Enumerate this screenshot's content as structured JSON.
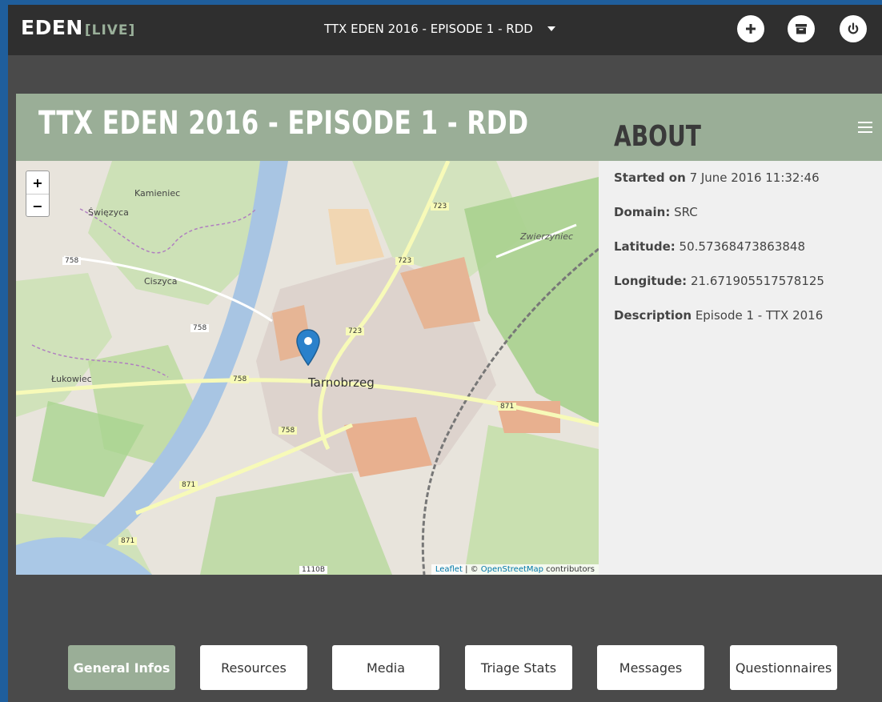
{
  "app": {
    "brand": "EDEN",
    "brand_suffix": "[LIVE]",
    "event_selector": "TTX EDEN 2016 - EPISODE 1 - RDD",
    "icons": [
      "plus-icon",
      "archive-icon",
      "power-icon"
    ]
  },
  "card": {
    "title": "TTX EDEN 2016 - EPISODE 1 - RDD"
  },
  "map": {
    "zoom_in": "+",
    "zoom_out": "−",
    "place_labels": [
      {
        "name": "Kamieniec"
      },
      {
        "name": "Święzyca"
      },
      {
        "name": "Ciszyca"
      },
      {
        "name": "Łukowiec"
      },
      {
        "name": "Tarnobrzeg"
      },
      {
        "name": "Zwierzyniec"
      }
    ],
    "road_labels": [
      "723",
      "723",
      "723",
      "758",
      "758",
      "758",
      "758",
      "871",
      "871",
      "871",
      "1110B"
    ],
    "attribution_leaflet": "Leaflet",
    "attribution_sep": " | © ",
    "attribution_osm": "OpenStreetMap",
    "attribution_tail": " contributors"
  },
  "about": {
    "heading": "ABOUT",
    "started_label": "Started on",
    "started_value": "7 June 2016 11:32:46",
    "domain_label": "Domain:",
    "domain_value": "SRC",
    "latitude_label": "Latitude:",
    "latitude_value": "50.57368473863848",
    "longitude_label": "Longitude:",
    "longitude_value": "21.671905517578125",
    "description_label": "Description",
    "description_value": "Episode 1 - TTX 2016"
  },
  "tabs": [
    {
      "label": "General Infos",
      "active": true
    },
    {
      "label": "Resources",
      "active": false
    },
    {
      "label": "Media",
      "active": false
    },
    {
      "label": "Triage Stats",
      "active": false
    },
    {
      "label": "Messages",
      "active": false
    },
    {
      "label": "Questionnaires",
      "active": false
    }
  ],
  "colors": {
    "accent": "#9aae97",
    "topbar": "#2f2f2f",
    "page": "#4a4a4a",
    "marker": "#2a81cb"
  }
}
